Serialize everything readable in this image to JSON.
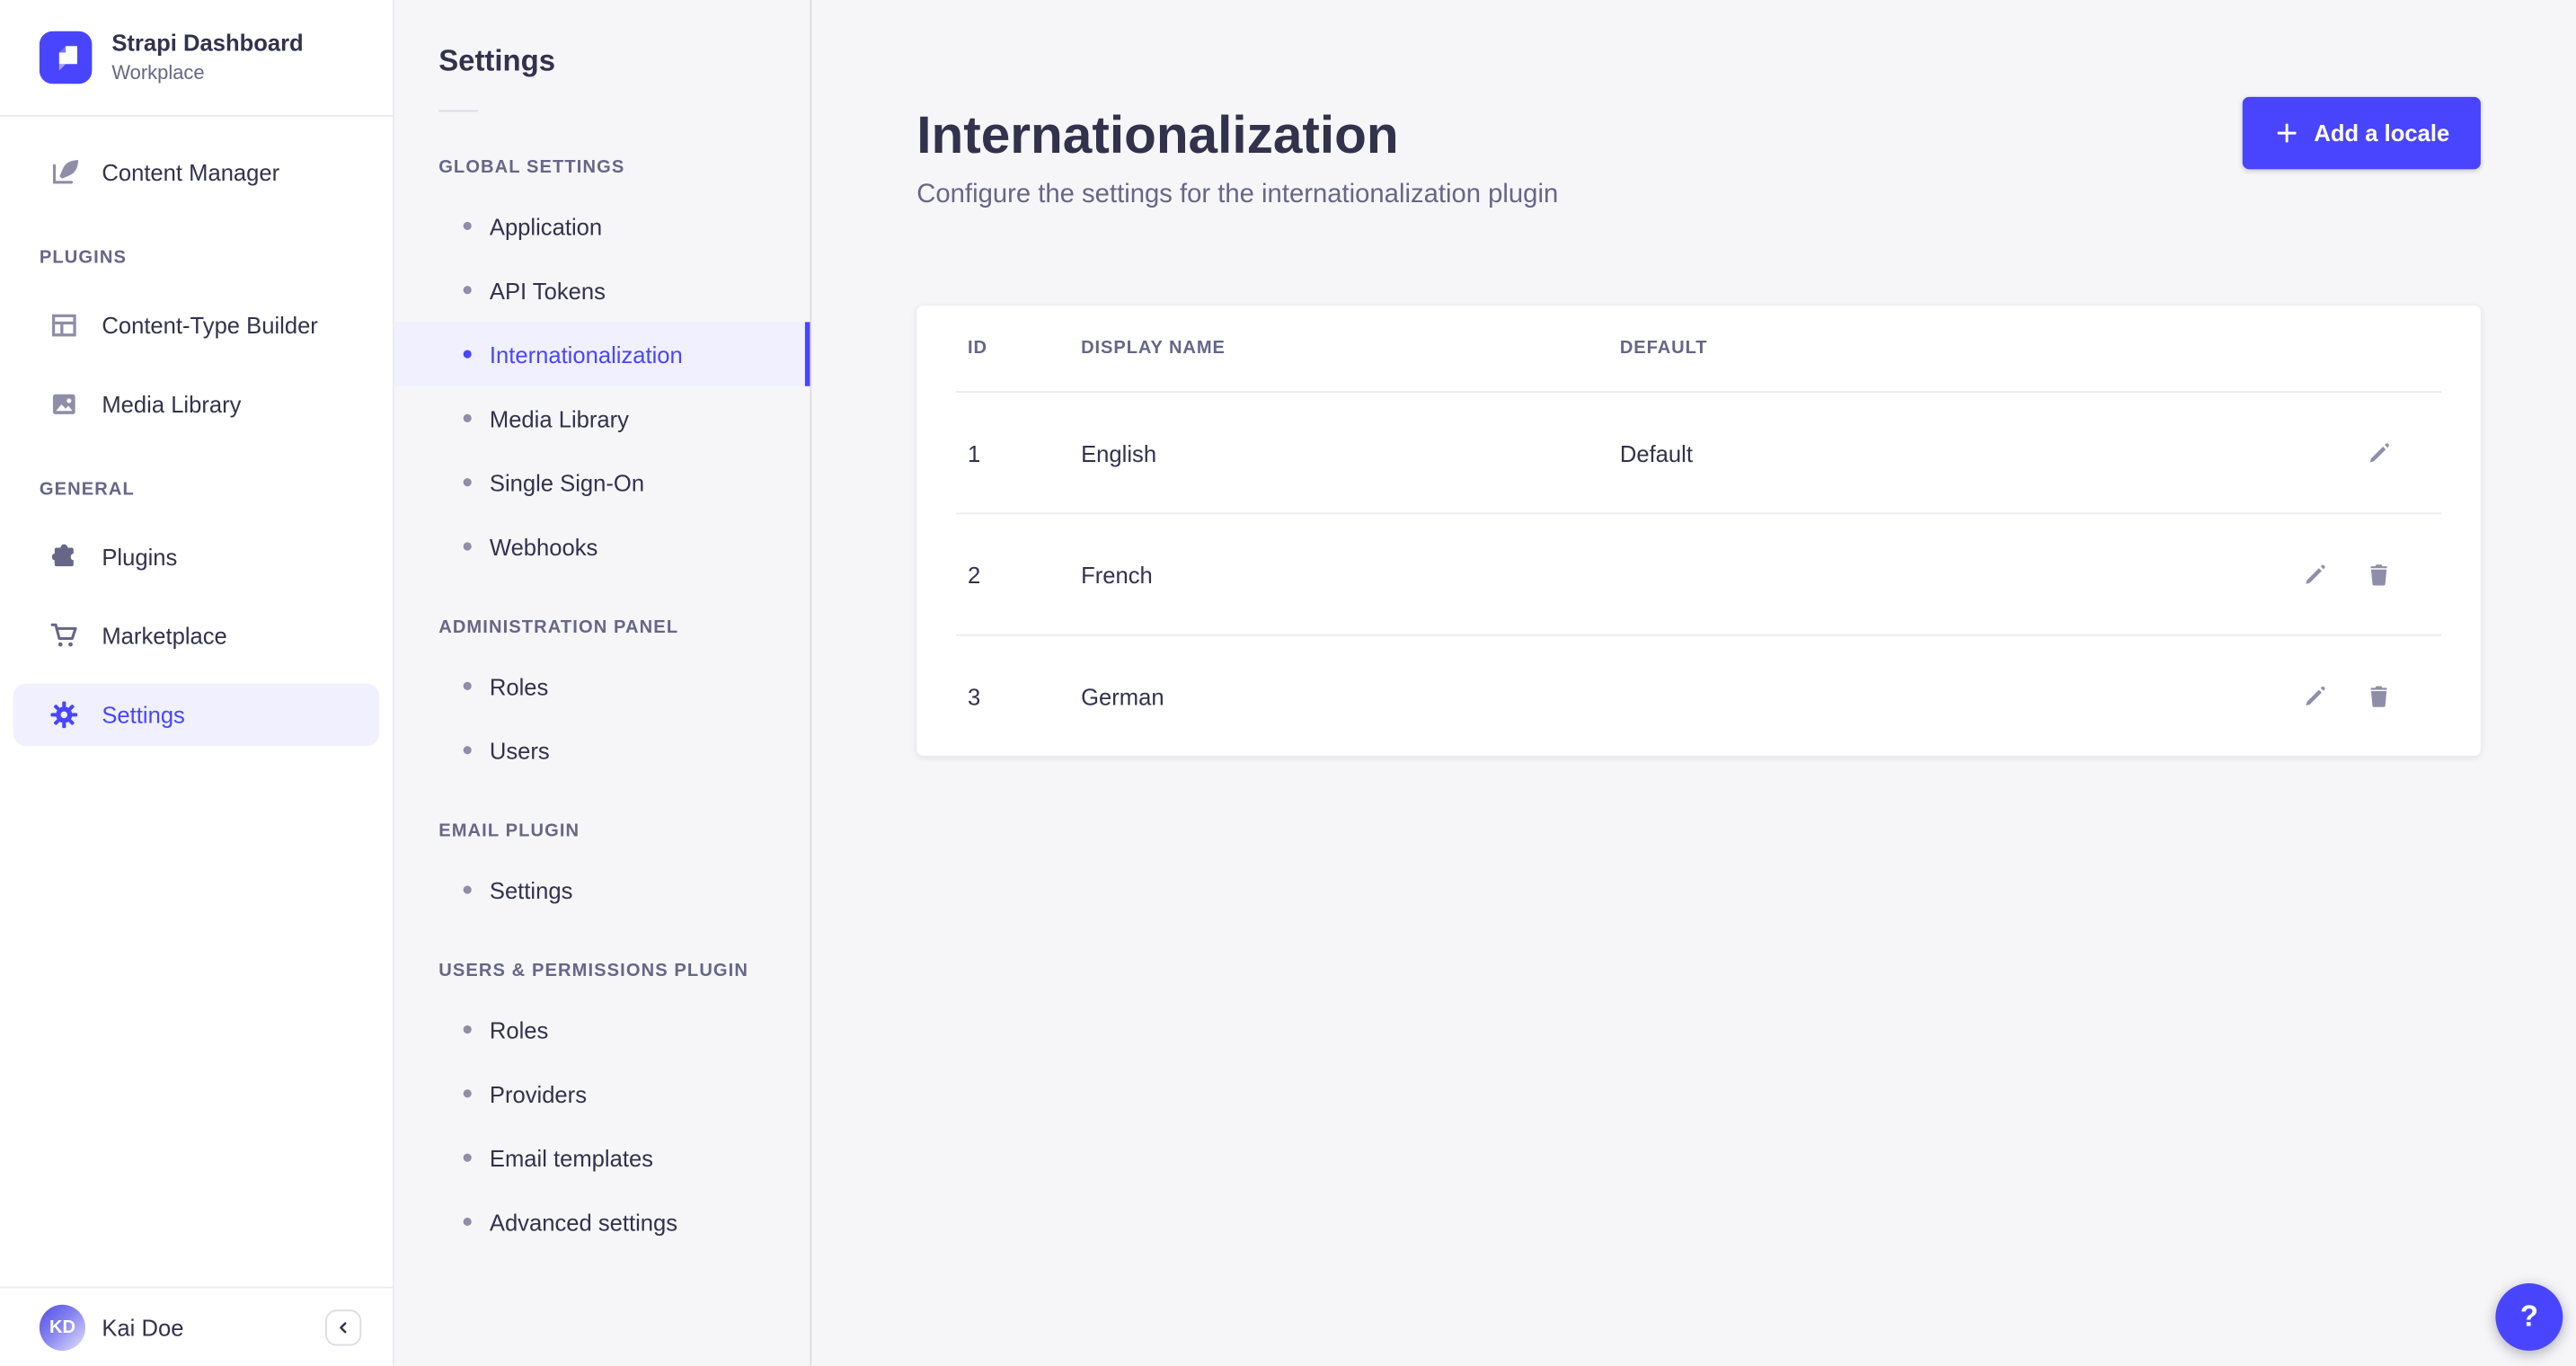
{
  "brand": {
    "title": "Strapi Dashboard",
    "workspace": "Workplace"
  },
  "colors": {
    "primary": "#4945ff",
    "primary_bg": "#f0f0ff",
    "text": "#32324d",
    "muted": "#666687",
    "icon_gray": "#8e8ea9",
    "border": "#eaeaef",
    "panel_bg": "#f6f6f9",
    "card_bg": "#ffffff"
  },
  "icons": {
    "brand": "strapi-logo",
    "content_manager": "feather-pen",
    "content_type_builder": "layout-grid",
    "media_library": "picture",
    "plugins": "puzzle-piece",
    "marketplace": "shopping-cart",
    "settings": "gear",
    "add": "plus",
    "edit": "pencil",
    "delete": "trash",
    "collapse": "chevron-left",
    "help": "question-mark"
  },
  "sidebar": {
    "content_manager": "Content Manager",
    "sections": [
      {
        "label": "PLUGINS",
        "items": [
          "Content-Type Builder",
          "Media Library"
        ]
      },
      {
        "label": "GENERAL",
        "items": [
          "Plugins",
          "Marketplace",
          "Settings"
        ]
      }
    ],
    "active_item": "Settings",
    "user_initials": "KD",
    "user_name": "Kai Doe"
  },
  "subnav": {
    "title": "Settings",
    "active_item": "Internationalization",
    "sections": [
      {
        "label": "GLOBAL SETTINGS",
        "items": [
          "Application",
          "API Tokens",
          "Internationalization",
          "Media Library",
          "Single Sign-On",
          "Webhooks"
        ]
      },
      {
        "label": "ADMINISTRATION PANEL",
        "items": [
          "Roles",
          "Users"
        ]
      },
      {
        "label": "EMAIL PLUGIN",
        "items": [
          "Settings"
        ]
      },
      {
        "label": "USERS & PERMISSIONS PLUGIN",
        "items": [
          "Roles",
          "Providers",
          "Email templates",
          "Advanced settings"
        ]
      }
    ]
  },
  "main": {
    "title": "Internationalization",
    "subtitle": "Configure the settings for the internationalization plugin",
    "add_button_label": "Add a locale",
    "table": {
      "headers": [
        "ID",
        "DISPLAY NAME",
        "DEFAULT"
      ],
      "rows": [
        {
          "id": "1",
          "display_name": "English",
          "default": "Default"
        },
        {
          "id": "2",
          "display_name": "French",
          "default": ""
        },
        {
          "id": "3",
          "display_name": "German",
          "default": ""
        }
      ]
    },
    "help_label": "?"
  }
}
